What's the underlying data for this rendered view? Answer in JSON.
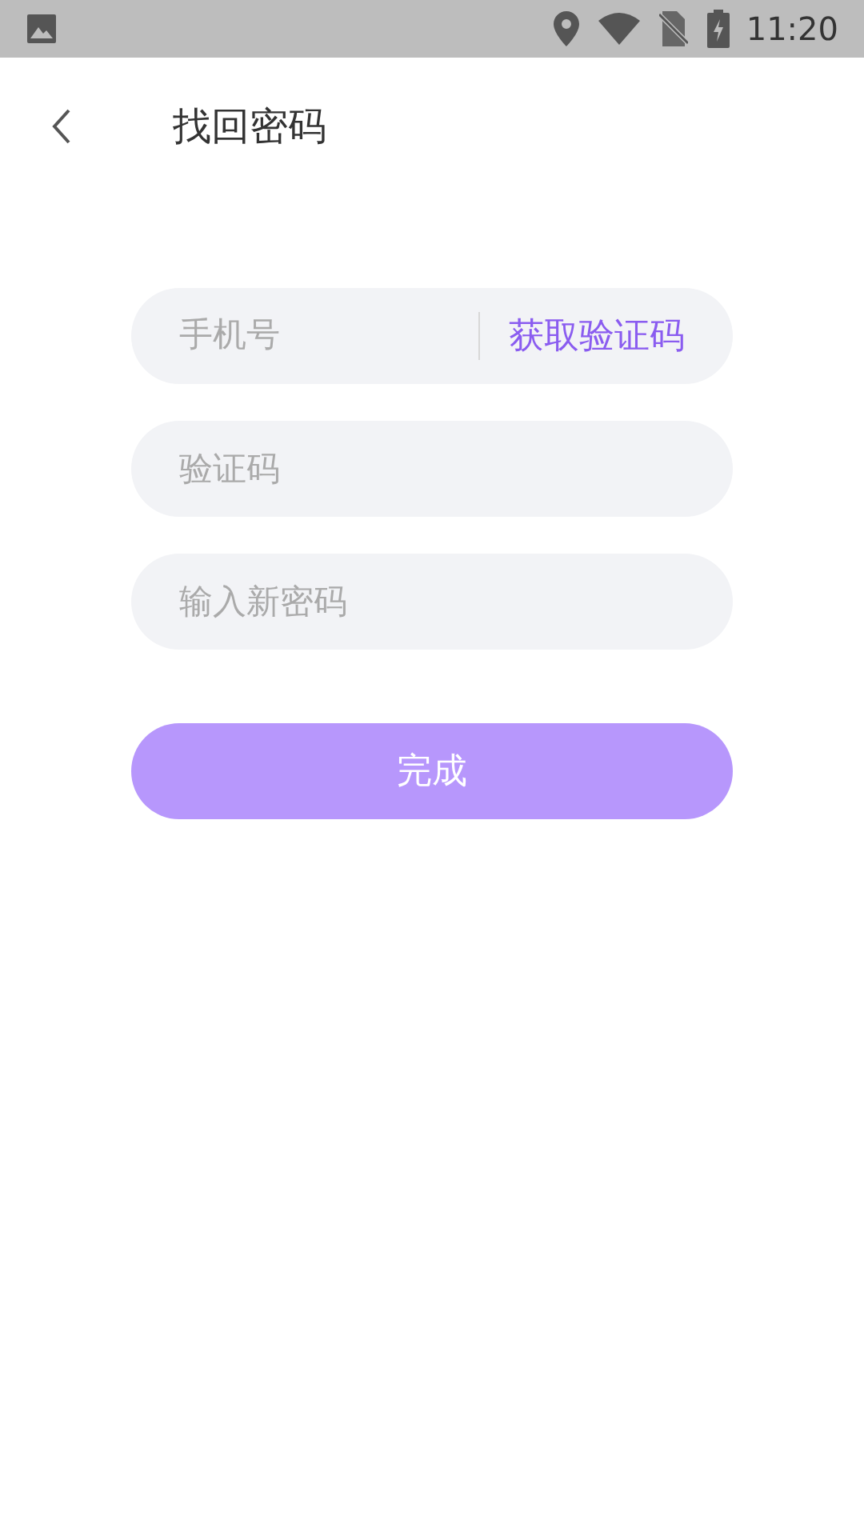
{
  "status_bar": {
    "time": "11:20"
  },
  "header": {
    "title": "找回密码"
  },
  "fields": [
    {
      "placeholder": "手机号",
      "action": "获取验证码"
    },
    {
      "placeholder": "验证码"
    },
    {
      "placeholder": "输入新密码"
    }
  ],
  "submit_button": {
    "label": "完成"
  }
}
